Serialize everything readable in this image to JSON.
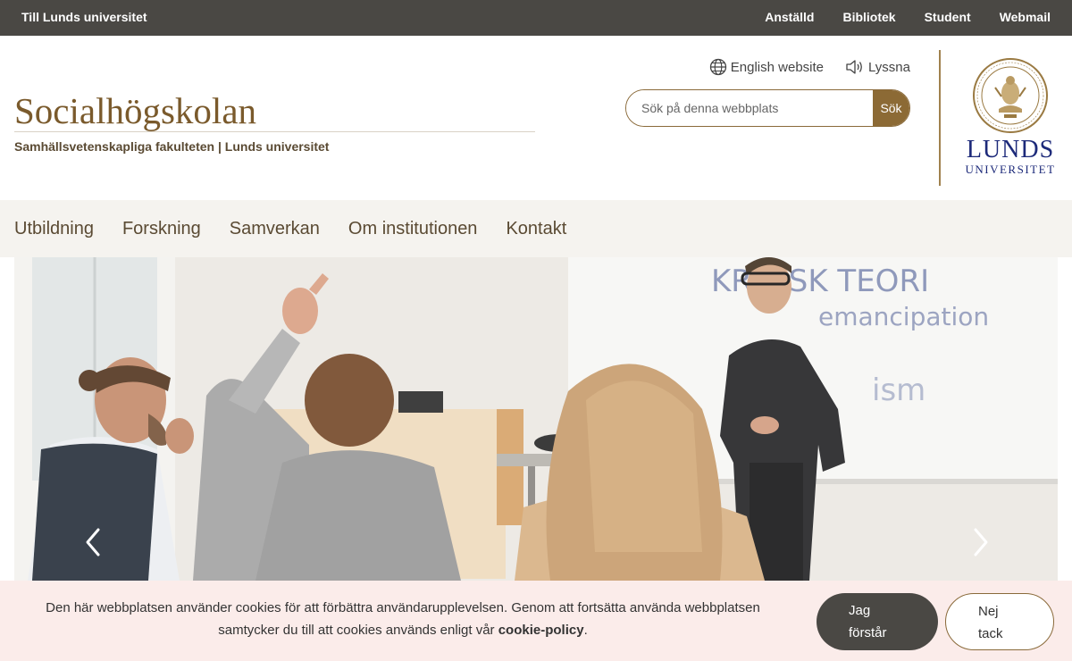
{
  "topbar": {
    "left_link": "Till Lunds universitet",
    "right_links": [
      "Anställd",
      "Bibliotek",
      "Student",
      "Webmail"
    ]
  },
  "header": {
    "title": "Socialhögskolan",
    "subtitle": "Samhällsvetenskapliga fakulteten | Lunds universitet",
    "english_link": "English website",
    "listen_link": "Lyssna",
    "search_placeholder": "Sök på denna webbplats",
    "search_button": "Sök",
    "logo_name": "LUNDS",
    "logo_sub": "UNIVERSITET"
  },
  "nav": {
    "items": [
      "Utbildning",
      "Forskning",
      "Samverkan",
      "Om institutionen",
      "Kontakt"
    ]
  },
  "hero": {
    "whiteboard_text": [
      "KRITISK TEORI",
      "emancipation",
      "ism"
    ]
  },
  "cookie": {
    "text_before": "Den här webbplatsen använder cookies för att förbättra användarupplevelsen. Genom att fortsätta använda webbplatsen samtycker du till att cookies används enligt vår ",
    "policy_link": "cookie-policy",
    "text_after": ".",
    "accept_line1": "Jag",
    "accept_line2": "förstår",
    "decline_line1": "Nej",
    "decline_line2": "tack"
  },
  "colors": {
    "topbar_bg": "#4a4844",
    "brand_brown": "#8c6a35",
    "title_brown": "#7a5a2c",
    "lu_blue": "#1d2a7a",
    "nav_bg": "#f5f3ef",
    "cookie_bg": "#fbecea"
  }
}
